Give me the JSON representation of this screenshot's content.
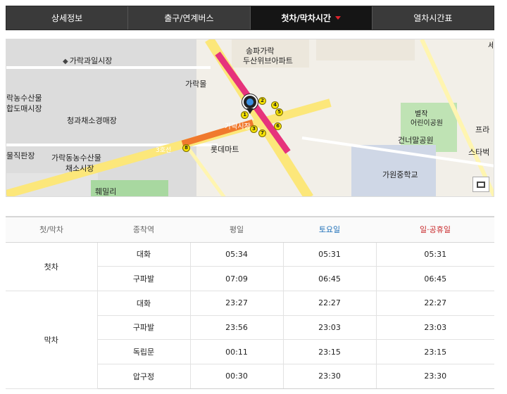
{
  "tabs": [
    {
      "label": "상세정보"
    },
    {
      "label": "출구/연계버스"
    },
    {
      "label": "첫차/막차시간"
    },
    {
      "label": "열차시간표"
    }
  ],
  "map": {
    "labels": {
      "garak_fruit_market": "가락과일시장",
      "songpa_garak_dusan": "송파가락",
      "dusan_apt": "두산위브아파트",
      "garak_mall": "가락몰",
      "agri_market_1": "락농수산물",
      "agri_market_2": "합도매시장",
      "vegetable_market": "청과채소경매장",
      "garak_station": "가락시장",
      "lotte_mart": "롯데마트",
      "agri_market_3": "가락동농수산물",
      "agri_market_4": "채소시장",
      "direct_market": "물직판장",
      "welfare": "훼밀리",
      "park": "건너말공원",
      "children_park": "별작",
      "children_park_2": "어린이공원",
      "school": "가원중학교",
      "prugio": "프라",
      "starbucks": "스타벅",
      "line3": "3호선",
      "top_right": "세"
    },
    "exits": [
      "1",
      "2",
      "3",
      "4",
      "5",
      "6",
      "7",
      "8"
    ],
    "colors": {
      "line8": "#e6337c",
      "line3": "#f0792d",
      "exit": "#f6e200"
    }
  },
  "table": {
    "headers": [
      "첫/막차",
      "종착역",
      "평일",
      "토요일",
      "일·공휴일"
    ],
    "groups": [
      {
        "label": "첫차",
        "rows": [
          {
            "dest": "대화",
            "weekday": "05:34",
            "sat": "05:31",
            "sun": "05:31"
          },
          {
            "dest": "구파발",
            "weekday": "07:09",
            "sat": "06:45",
            "sun": "06:45"
          }
        ]
      },
      {
        "label": "막차",
        "rows": [
          {
            "dest": "대화",
            "weekday": "23:27",
            "sat": "22:27",
            "sun": "22:27"
          },
          {
            "dest": "구파발",
            "weekday": "23:56",
            "sat": "23:03",
            "sun": "23:03"
          },
          {
            "dest": "독립문",
            "weekday": "00:11",
            "sat": "23:15",
            "sun": "23:15"
          },
          {
            "dest": "압구정",
            "weekday": "00:30",
            "sat": "23:30",
            "sun": "23:30"
          }
        ]
      }
    ]
  }
}
